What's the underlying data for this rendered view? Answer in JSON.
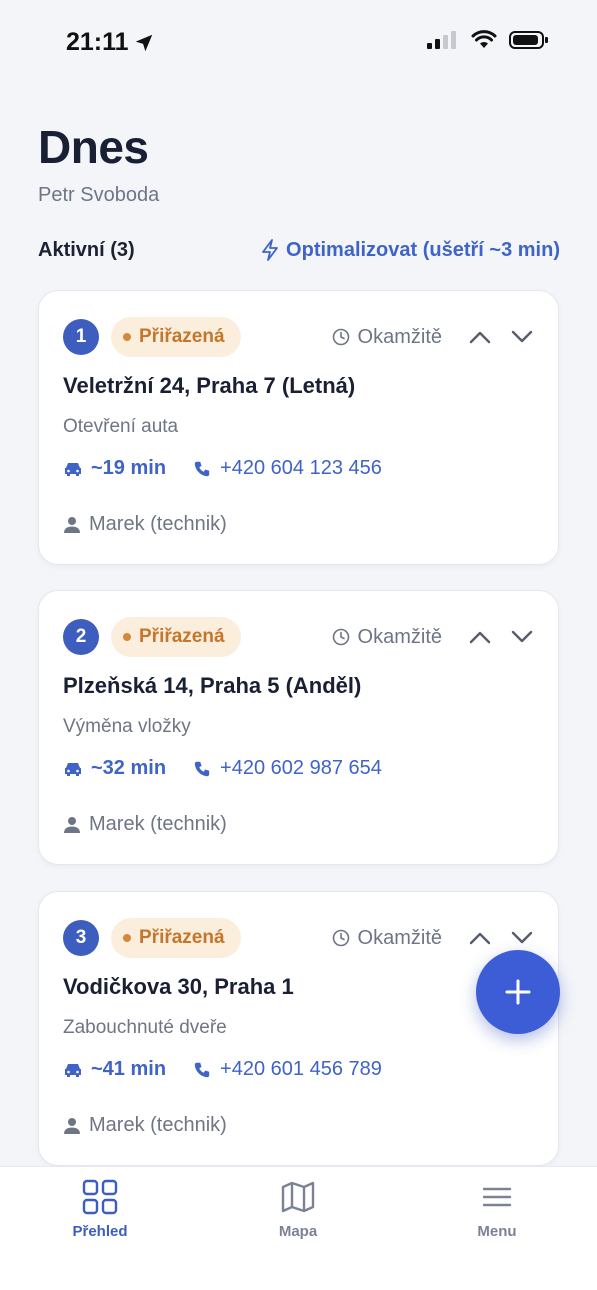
{
  "status_bar": {
    "time": "21:11"
  },
  "header": {
    "title": "Dnes",
    "subtitle": "Petr Svoboda"
  },
  "section": {
    "label": "Aktivní (3)",
    "optimize_label": "Optimalizovat (ušetří ~3 min)"
  },
  "orders": [
    {
      "number": "1",
      "status": "Přiřazená",
      "time": "Okamžitě",
      "address": "Veletržní 24, Praha 7 (Letná)",
      "service": "Otevření auta",
      "eta": "~19 min",
      "phone": "+420 604 123 456",
      "technician": "Marek (technik)"
    },
    {
      "number": "2",
      "status": "Přiřazená",
      "time": "Okamžitě",
      "address": "Plzeňská 14, Praha 5 (Anděl)",
      "service": "Výměna vložky",
      "eta": "~32 min",
      "phone": "+420 602 987 654",
      "technician": "Marek (technik)"
    },
    {
      "number": "3",
      "status": "Přiřazená",
      "time": "Okamžitě",
      "address": "Vodičkova 30, Praha 1",
      "service": "Zabouchnuté dveře",
      "eta": "~41 min",
      "phone": "+420 601 456 789",
      "technician": "Marek (technik)"
    }
  ],
  "tabs": [
    {
      "label": "Přehled",
      "icon": "grid-icon",
      "active": true
    },
    {
      "label": "Mapa",
      "icon": "map-icon",
      "active": false
    },
    {
      "label": "Menu",
      "icon": "hamburger-icon",
      "active": false
    }
  ],
  "colors": {
    "accent": "#3d5dbf",
    "badge_bg": "#fbeedd",
    "badge_text": "#c6762b"
  }
}
